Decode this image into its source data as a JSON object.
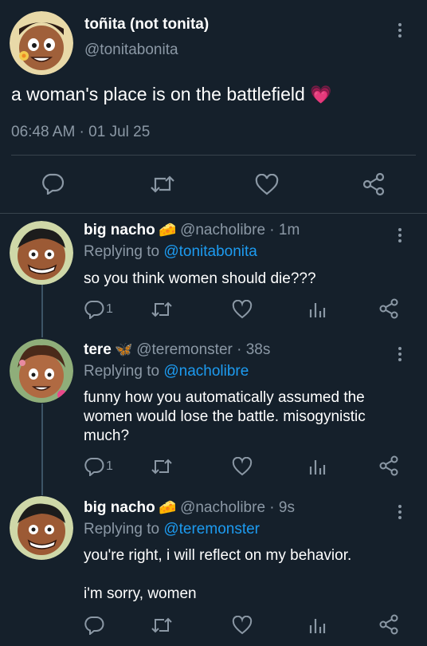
{
  "main_tweet": {
    "display_name": "toñita (not tonita)",
    "handle": "@tonitabonita",
    "text": "a woman's place is on the battlefield",
    "emoji": "💗",
    "timestamp": "06:48 AM · 01 Jul 25"
  },
  "replies": [
    {
      "display_name": "big nacho",
      "handle_meta": "@nacholibre · 1m",
      "replying_prefix": "Replying to",
      "replying_to": "@tonitabonita",
      "lines": [
        "so you think women should die???"
      ],
      "reply_count": "1"
    },
    {
      "display_name": "tere",
      "handle_meta": "@teremonster · 38s",
      "replying_prefix": "Replying to",
      "replying_to": "@nacholibre",
      "lines": [
        "funny how you automatically assumed the",
        "women would lose the battle. misogynistic",
        "much?"
      ],
      "reply_count": "1"
    },
    {
      "display_name": "big nacho",
      "handle_meta": "@nacholibre · 9s",
      "replying_prefix": "Replying to",
      "replying_to": "@teremonster",
      "lines": [
        "you're right, i will reflect on my behavior.",
        "",
        "i'm sorry, women"
      ],
      "reply_count": ""
    }
  ],
  "icons": {
    "reply": "reply-icon",
    "retweet": "retweet-icon",
    "like": "heart-icon",
    "views": "views-icon",
    "share": "share-icon",
    "more": "more-icon",
    "cheese": "cheese-emoji-icon",
    "butterfly": "butterfly-emoji-icon"
  },
  "colors": {
    "background": "#15202b",
    "secondary_text": "#8b98a5",
    "link": "#1d9bf0",
    "divider": "#38444d"
  }
}
